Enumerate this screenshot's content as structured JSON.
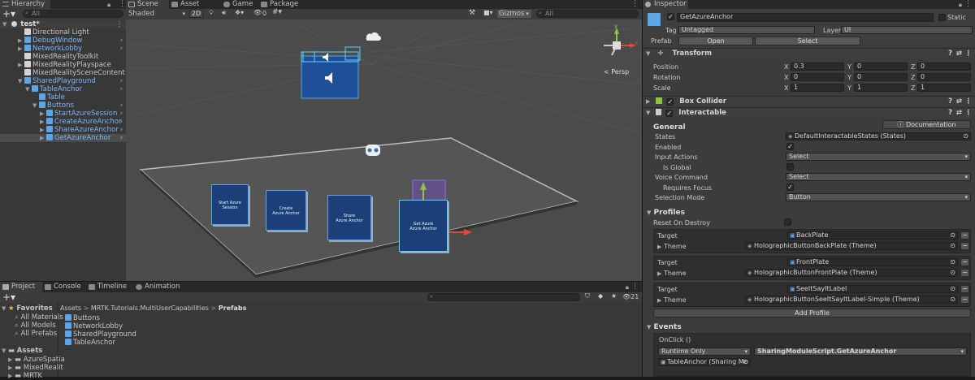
{
  "hierarchy": {
    "tab_label": "Hierarchy",
    "search_placeholder": "All",
    "scene_name": "test*",
    "items": [
      {
        "label": "Directional Light",
        "indent": 0,
        "color": "white",
        "expand": false
      },
      {
        "label": "DebugWindow",
        "indent": 0,
        "color": "blue",
        "expand": true
      },
      {
        "label": "NetworkLobby",
        "indent": 0,
        "color": "blue",
        "expand": true
      },
      {
        "label": "MixedRealityToolkit",
        "indent": 0,
        "color": "white",
        "expand": false
      },
      {
        "label": "MixedRealityPlayspace",
        "indent": 0,
        "color": "white",
        "expand": true
      },
      {
        "label": "MixedRealitySceneContent",
        "indent": 0,
        "color": "white",
        "expand": false
      },
      {
        "label": "SharedPlayground",
        "indent": 0,
        "color": "blue",
        "expand": true
      },
      {
        "label": "TableAnchor",
        "indent": 1,
        "color": "blue",
        "expand": true
      },
      {
        "label": "Table",
        "indent": 2,
        "color": "blue",
        "expand": false
      },
      {
        "label": "Buttons",
        "indent": 2,
        "color": "blue",
        "expand": true
      },
      {
        "label": "StartAzureSession",
        "indent": 3,
        "color": "blue",
        "expand": true
      },
      {
        "label": "CreateAzureAnchor",
        "indent": 3,
        "color": "blue",
        "expand": true
      },
      {
        "label": "ShareAzureAnchor",
        "indent": 3,
        "color": "blue",
        "expand": true
      },
      {
        "label": "GetAzureAnchor",
        "indent": 3,
        "color": "blue",
        "expand": true
      }
    ]
  },
  "scene": {
    "tabs": [
      "Scene",
      "Asset Store",
      "Game",
      "Package Manager"
    ],
    "shading": "Shaded",
    "mode_2d": "2D",
    "gizmo_count": "0",
    "gizmos_label": "Gizmos",
    "search_placeholder": "All",
    "persp_label": "< Persp",
    "axis_y": "y",
    "axis_x": "x",
    "buttons": [
      {
        "line1": "Start Azure",
        "line2": "Session"
      },
      {
        "line1": "Create",
        "line2": "Azure Anchor"
      },
      {
        "line1": "Share",
        "line2": "Azure Anchor"
      },
      {
        "line1": "Get Azure",
        "line2": "Azure Anchor"
      }
    ]
  },
  "project": {
    "tabs": [
      "Project",
      "Console",
      "Timeline",
      "Animation"
    ],
    "count_badge": "21",
    "favorites_label": "Favorites",
    "favorites": [
      "All Materials",
      "All Models",
      "All Prefabs"
    ],
    "assets_label": "Assets",
    "asset_folders": [
      "AzureSpatia",
      "MixedRealit",
      "MRTK"
    ],
    "breadcrumb": [
      "Assets",
      "MRTK.Tutorials.MultiUserCapabilities",
      "Prefabs"
    ],
    "files": [
      "Buttons",
      "NetworkLobby",
      "SharedPlayground",
      "TableAnchor"
    ]
  },
  "inspector": {
    "tab_label": "Inspector",
    "object_name": "GetAzureAnchor",
    "static_label": "Static",
    "tag_label": "Tag",
    "tag_value": "Untagged",
    "layer_label": "Layer",
    "layer_value": "UI",
    "prefab_label": "Prefab",
    "open_label": "Open",
    "select_label": "Select",
    "transform": {
      "title": "Transform",
      "rows": [
        {
          "label": "Position",
          "x": "0.3",
          "y": "0",
          "z": "0"
        },
        {
          "label": "Rotation",
          "x": "0",
          "y": "0",
          "z": "0"
        },
        {
          "label": "Scale",
          "x": "1",
          "y": "1",
          "z": "1"
        }
      ]
    },
    "box_collider": "Box Collider",
    "interactable": "Interactable",
    "general_label": "General",
    "documentation_label": "Documentation",
    "states_label": "States",
    "states_value": "DefaultInteractableStates (States)",
    "enabled_label": "Enabled",
    "input_actions_label": "Input Actions",
    "input_actions_value": "Select",
    "is_global_label": "Is Global",
    "voice_command_label": "Voice Command",
    "voice_command_value": "Select",
    "requires_focus_label": "Requires Focus",
    "selection_mode_label": "Selection Mode",
    "selection_mode_value": "Button",
    "profiles_label": "Profiles",
    "reset_on_destroy_label": "Reset On Destroy",
    "profiles": [
      {
        "target_label": "Target",
        "target": "BackPlate",
        "theme_label": "Theme",
        "theme": "HolographicButtonBackPlate (Theme)"
      },
      {
        "target_label": "Target",
        "target": "FrontPlate",
        "theme_label": "Theme",
        "theme": "HolographicButtonFrontPlate (Theme)"
      },
      {
        "target_label": "Target",
        "target": "SeeItSayItLabel",
        "theme_label": "Theme",
        "theme": "HolographicButtonSeeItSayItLabel-Simple (Theme)"
      }
    ],
    "add_profile_label": "Add Profile",
    "events_label": "Events",
    "onclick_label": "OnClick ()",
    "runtime_value": "Runtime Only",
    "function_value": "SharingModuleScript.GetAzureAnchor",
    "object_value": "TableAnchor (Sharing Mo"
  }
}
